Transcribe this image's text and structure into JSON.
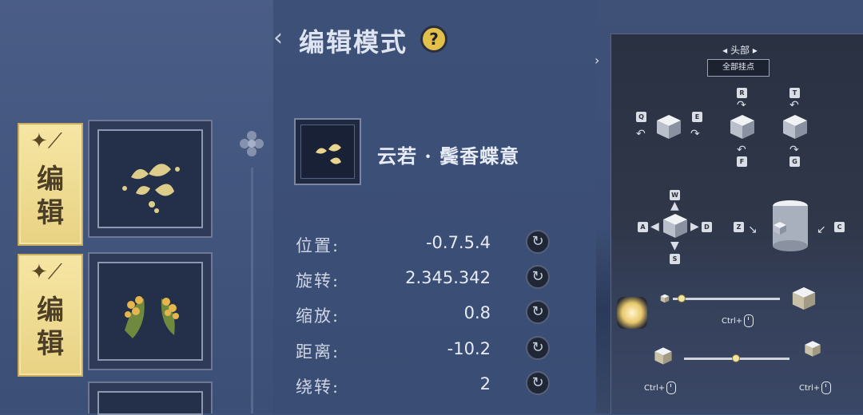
{
  "left": {
    "edit_tabs": [
      {
        "label": "编\n辑"
      },
      {
        "label": "编\n辑"
      }
    ]
  },
  "middle": {
    "title": "编辑模式",
    "help_label": "?",
    "item_name": "云若 · 鬓香蝶意",
    "properties": [
      {
        "label": "位置:",
        "value": "-0.7.5.4"
      },
      {
        "label": "旋转:",
        "value": "2.345.342"
      },
      {
        "label": "缩放:",
        "value": "0.8"
      },
      {
        "label": "距离:",
        "value": "-10.2"
      },
      {
        "label": "绕转:",
        "value": "2"
      }
    ]
  },
  "right": {
    "node_label": "头部",
    "node_button": "全部挂点",
    "keys": {
      "q": "Q",
      "e": "E",
      "r": "R",
      "f": "F",
      "t": "T",
      "g": "G",
      "w": "W",
      "a": "A",
      "s": "S",
      "d": "D",
      "z": "Z",
      "c": "C"
    },
    "ctrl_label_1": "Ctrl+",
    "ctrl_label_2": "Ctrl+",
    "ctrl_label_3": "Ctrl+"
  }
}
